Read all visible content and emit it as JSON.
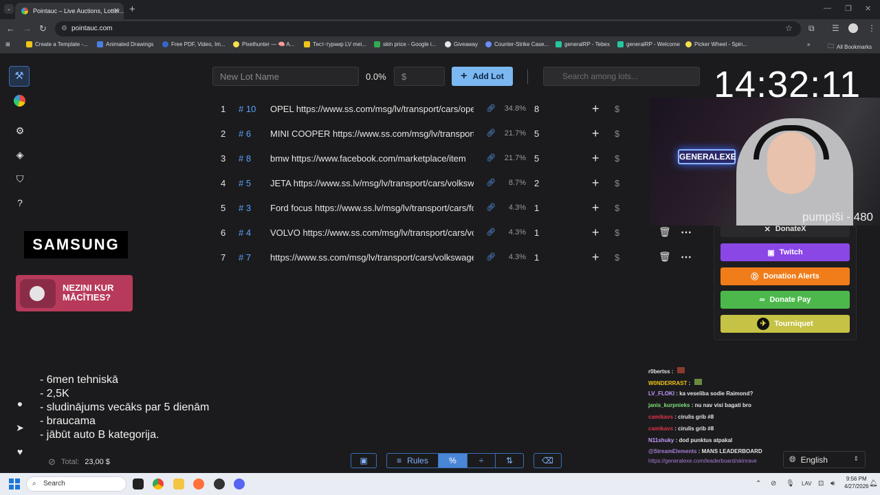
{
  "browser": {
    "tab_title": "Pointauc – Live Auctions, Lotter...",
    "url": "pointauc.com",
    "bookmarks": [
      "Create a Template -...",
      "Animated Drawings",
      "Free PDF, Video, Im...",
      "Pixelhunter — 🧠 A...",
      "Тест-турнир LV mei...",
      "skin price - Google i...",
      "Giveaway",
      "Counter-Strike Case...",
      "generalRP - Tebex",
      "generalRP - Welcome",
      "Picker Wheel - Spin..."
    ],
    "all_bookmarks": "All Bookmarks"
  },
  "controls": {
    "lot_name_placeholder": "New Lot Name",
    "percent": "0.0%",
    "amount_placeholder": "$",
    "add_lot": "Add Lot",
    "search_placeholder": "Search among lots..."
  },
  "lots": [
    {
      "rank": "1",
      "id": "# 10",
      "name": "OPEL https://www.ss.com/msg/lv/transport/cars/opel",
      "pct": "34.8%",
      "amount": "8"
    },
    {
      "rank": "2",
      "id": "# 6",
      "name": "MINI COOPER https://www.ss.com/msg/lv/transport/cars/mini",
      "pct": "21.7%",
      "amount": "5"
    },
    {
      "rank": "3",
      "id": "# 8",
      "name": "bmw  https://www.facebook.com/marketplace/item",
      "pct": "21.7%",
      "amount": "5"
    },
    {
      "rank": "4",
      "id": "# 5",
      "name": "JETA https://www.ss.lv/msg/lv/transport/cars/volkswagen",
      "pct": "8.7%",
      "amount": "2"
    },
    {
      "rank": "5",
      "id": "# 3",
      "name": "Ford focus https://www.ss.lv/msg/lv/transport/cars/ford",
      "pct": "4.3%",
      "amount": "1"
    },
    {
      "rank": "6",
      "id": "# 4",
      "name": "VOLVO https://www.ss.com/msg/lv/transport/cars/volvo",
      "pct": "4.3%",
      "amount": "1"
    },
    {
      "rank": "7",
      "id": "# 7",
      "name": "https://www.ss.com/msg/lv/transport/cars/volkswagen",
      "pct": "4.3%",
      "amount": "1"
    }
  ],
  "clock": "14:32:11",
  "webcam": {
    "neon_sign": "GENERALEXE",
    "caption": "pumpīši - 480"
  },
  "donations": {
    "donatex": "DonateX",
    "twitch": "Twitch",
    "donation_alerts": "Donation Alerts",
    "donate_pay": "Donate Pay",
    "tourniquet": "Tourniquet"
  },
  "ads": {
    "samsung": "SAMSUNG",
    "banner": "NEZINI KUR MĀCĪTIES?"
  },
  "notes": [
    "- 6men tehniskā",
    "- 2,5K",
    "- sludinājums vecāks par 5 dienām",
    "- braucama",
    "- jābūt auto B kategorija."
  ],
  "total": {
    "label": "Total:",
    "value": "23,00 $"
  },
  "chat": [
    {
      "user": "r0bertss",
      "msg": "",
      "color": "#e6e6e6"
    },
    {
      "user": "W0NDERRAST",
      "msg": "",
      "color": "#f0c419"
    },
    {
      "user": "LV_FLOKI",
      "msg": "ka veseliba sodie Raimond?",
      "color": "#c39bff"
    },
    {
      "user": "janis_kurpnieks",
      "msg": "nu nav visi bagati bro",
      "color": "#7fe07a"
    },
    {
      "user": "camikavs",
      "msg": "cirulis grib #8",
      "color": "#e0334a"
    },
    {
      "user": "camikavs",
      "msg": "cirulis grib #8",
      "color": "#e0334a"
    },
    {
      "user": "N11shuky",
      "msg": "dod punktus atpakal",
      "color": "#c39bff"
    },
    {
      "user": "@StreamElements",
      "msg": "MANS LEADERBOARD",
      "color": "#a57dd6"
    }
  ],
  "chat_link": "https://generalexe.com/leaderboard/skinrave",
  "language": "English",
  "bottom_toolbar": {
    "rules": "Rules"
  },
  "taskbar": {
    "search": "Search",
    "lang": "LAV",
    "time": "9:56 PM",
    "date": "4/27/2026"
  }
}
